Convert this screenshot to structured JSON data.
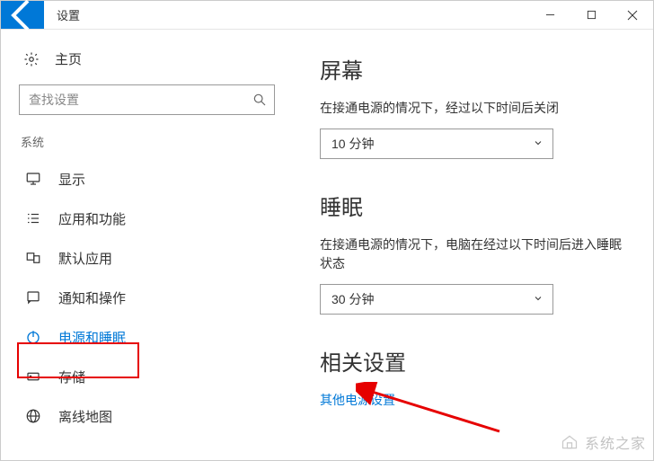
{
  "titlebar": {
    "title": "设置"
  },
  "sidebar": {
    "home_label": "主页",
    "search_placeholder": "查找设置",
    "category_label": "系统",
    "items": [
      {
        "label": "显示"
      },
      {
        "label": "应用和功能"
      },
      {
        "label": "默认应用"
      },
      {
        "label": "通知和操作"
      },
      {
        "label": "电源和睡眠"
      },
      {
        "label": "存储"
      },
      {
        "label": "离线地图"
      }
    ]
  },
  "main": {
    "screen": {
      "title": "屏幕",
      "desc": "在接通电源的情况下，经过以下时间后关闭",
      "value": "10 分钟"
    },
    "sleep": {
      "title": "睡眠",
      "desc": "在接通电源的情况下，电脑在经过以下时间后进入睡眠状态",
      "value": "30 分钟"
    },
    "related": {
      "title": "相关设置",
      "link": "其他电源设置"
    }
  },
  "watermark": "系统之家"
}
